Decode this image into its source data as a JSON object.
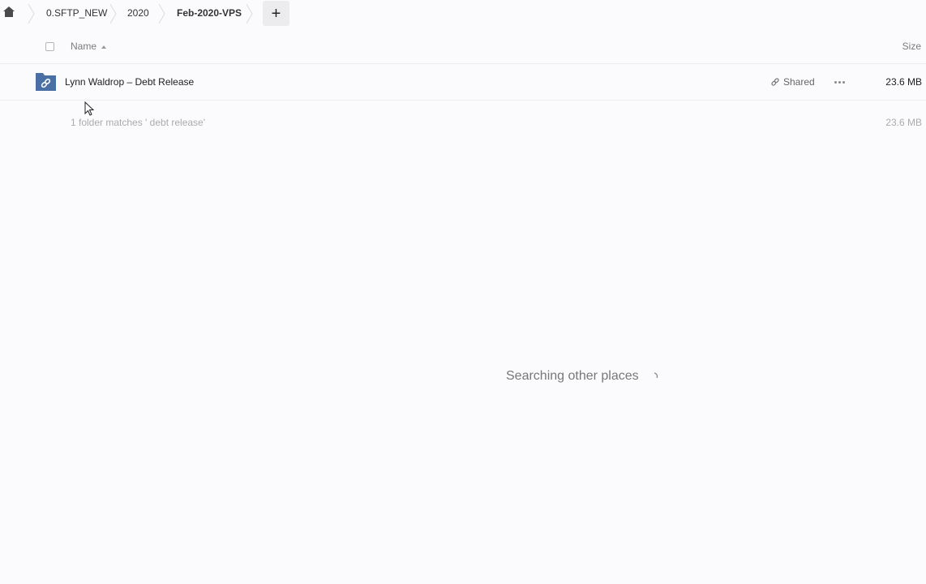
{
  "breadcrumb": {
    "home_icon": "home-icon",
    "items": [
      "0.SFTP_NEW",
      "2020",
      "Feb-2020-VPS"
    ],
    "add_label": "+"
  },
  "header": {
    "name_label": "Name",
    "size_label": "Size"
  },
  "files": [
    {
      "name": "Lynn Waldrop – Debt Release",
      "icon": "shared-folder-icon",
      "shared_label": "Shared",
      "size": "23.6 MB"
    }
  ],
  "summary": {
    "text": "1 folder matches ' debt release'",
    "size": "23.6 MB"
  },
  "status": {
    "searching_text": "Searching other places"
  },
  "colors": {
    "folder": "#4a6fa5",
    "background": "#fbfbfd"
  }
}
